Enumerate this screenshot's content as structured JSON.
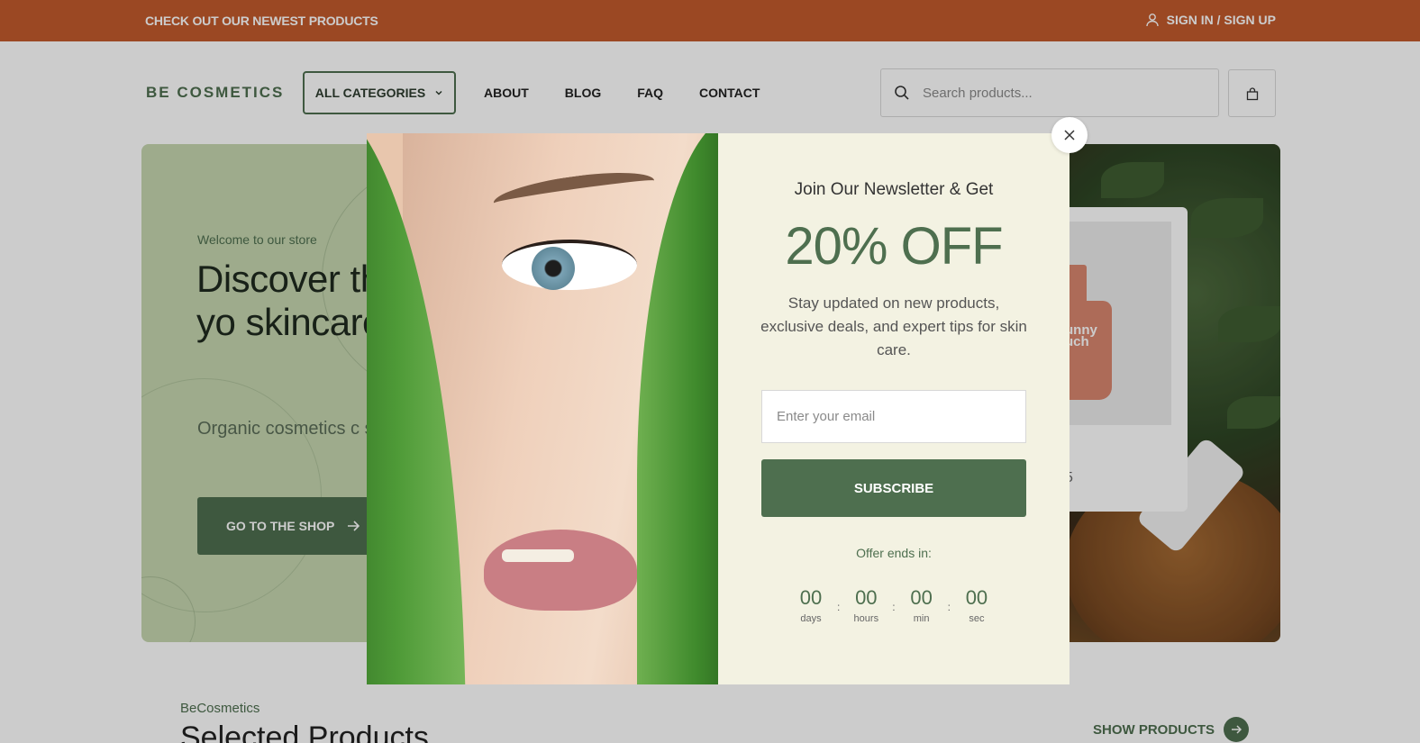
{
  "topbar": {
    "promo": "CHECK OUT OUR NEWEST PRODUCTS",
    "signin": "SIGN IN / SIGN UP",
    "signin_icon": "user-icon"
  },
  "header": {
    "logo": "BE COSMETICS",
    "all_categories": "ALL CATEGORIES",
    "nav": [
      "ABOUT",
      "BLOG",
      "FAQ",
      "CONTACT"
    ],
    "search_placeholder": "Search products...",
    "search_icon": "search-icon",
    "cart_icon": "shopping-bag-icon"
  },
  "hero": {
    "welcome": "Welcome to our store",
    "headline": "Discover th nature in yo skincare ro",
    "description": "Organic cosmetics c skin and the planet. N",
    "cta": "GO TO THE SHOP",
    "product_label": "unny uch",
    "price_fragment": "5"
  },
  "section": {
    "brand": "BeCosmetics",
    "title": "Selected Products",
    "show_products": "SHOW PRODUCTS"
  },
  "modal": {
    "heading": "Join Our Newsletter & Get",
    "discount": "20% OFF",
    "pitch": "Stay updated on new products, exclusive deals, and expert tips for skin care.",
    "email_placeholder": "Enter your email",
    "subscribe": "SUBSCRIBE",
    "offer_ends": "Offer ends in:",
    "countdown": [
      {
        "value": "00",
        "label": "days"
      },
      {
        "value": "00",
        "label": "hours"
      },
      {
        "value": "00",
        "label": "min"
      },
      {
        "value": "00",
        "label": "sec"
      }
    ],
    "close_icon": "close-icon"
  },
  "colors": {
    "topbar": "#c25a2c",
    "brand_green": "#4e6f4f",
    "hero_bg": "#c6d6b0",
    "modal_bg": "#f3f2e2"
  }
}
